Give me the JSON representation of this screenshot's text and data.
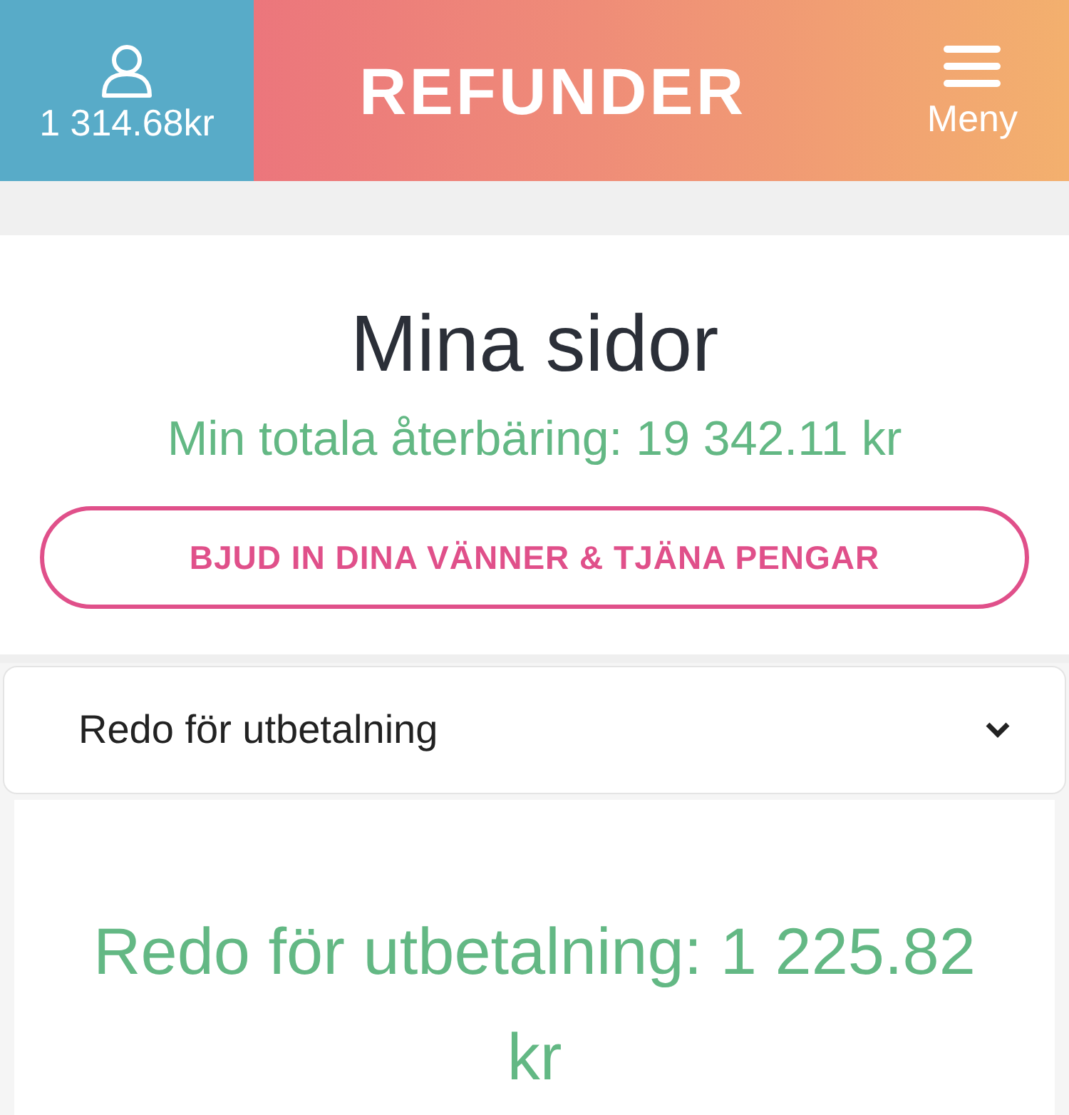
{
  "header": {
    "balance": "1 314.68kr",
    "logo": "REFUNDER",
    "menu_label": "Meny"
  },
  "page": {
    "title": "Mina sidor",
    "total": "Min totala återbäring: 19 342.11 kr",
    "invite_button": "BJUD IN DINA VÄNNER & TJÄNA PENGAR"
  },
  "dropdown": {
    "value": "Redo för utbetalning"
  },
  "panel": {
    "amount": "Redo för utbetalning: 1 225.82 kr"
  }
}
